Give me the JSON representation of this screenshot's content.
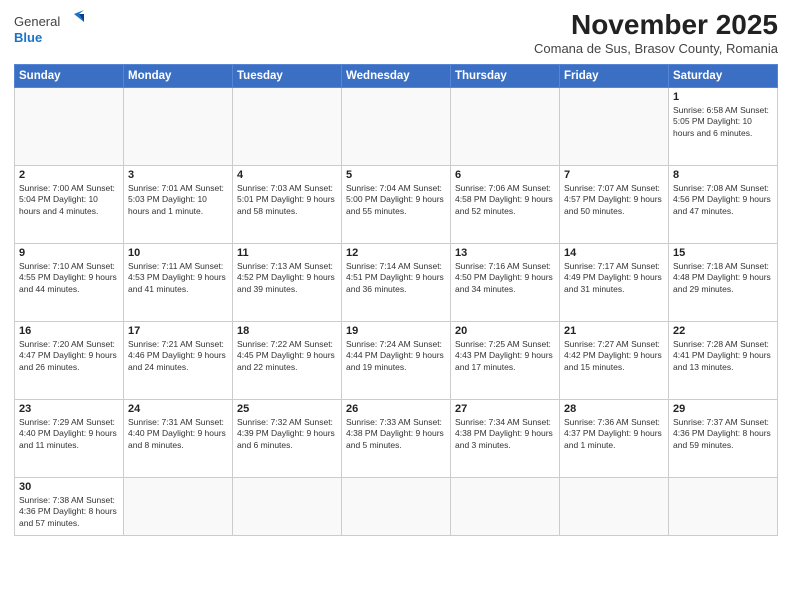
{
  "logo": {
    "general": "General",
    "blue": "Blue"
  },
  "header": {
    "month_title": "November 2025",
    "subtitle": "Comana de Sus, Brasov County, Romania"
  },
  "days_of_week": [
    "Sunday",
    "Monday",
    "Tuesday",
    "Wednesday",
    "Thursday",
    "Friday",
    "Saturday"
  ],
  "weeks": [
    [
      {
        "day": "",
        "info": ""
      },
      {
        "day": "",
        "info": ""
      },
      {
        "day": "",
        "info": ""
      },
      {
        "day": "",
        "info": ""
      },
      {
        "day": "",
        "info": ""
      },
      {
        "day": "",
        "info": ""
      },
      {
        "day": "1",
        "info": "Sunrise: 6:58 AM\nSunset: 5:05 PM\nDaylight: 10 hours and 6 minutes."
      }
    ],
    [
      {
        "day": "2",
        "info": "Sunrise: 7:00 AM\nSunset: 5:04 PM\nDaylight: 10 hours and 4 minutes."
      },
      {
        "day": "3",
        "info": "Sunrise: 7:01 AM\nSunset: 5:03 PM\nDaylight: 10 hours and 1 minute."
      },
      {
        "day": "4",
        "info": "Sunrise: 7:03 AM\nSunset: 5:01 PM\nDaylight: 9 hours and 58 minutes."
      },
      {
        "day": "5",
        "info": "Sunrise: 7:04 AM\nSunset: 5:00 PM\nDaylight: 9 hours and 55 minutes."
      },
      {
        "day": "6",
        "info": "Sunrise: 7:06 AM\nSunset: 4:58 PM\nDaylight: 9 hours and 52 minutes."
      },
      {
        "day": "7",
        "info": "Sunrise: 7:07 AM\nSunset: 4:57 PM\nDaylight: 9 hours and 50 minutes."
      },
      {
        "day": "8",
        "info": "Sunrise: 7:08 AM\nSunset: 4:56 PM\nDaylight: 9 hours and 47 minutes."
      }
    ],
    [
      {
        "day": "9",
        "info": "Sunrise: 7:10 AM\nSunset: 4:55 PM\nDaylight: 9 hours and 44 minutes."
      },
      {
        "day": "10",
        "info": "Sunrise: 7:11 AM\nSunset: 4:53 PM\nDaylight: 9 hours and 41 minutes."
      },
      {
        "day": "11",
        "info": "Sunrise: 7:13 AM\nSunset: 4:52 PM\nDaylight: 9 hours and 39 minutes."
      },
      {
        "day": "12",
        "info": "Sunrise: 7:14 AM\nSunset: 4:51 PM\nDaylight: 9 hours and 36 minutes."
      },
      {
        "day": "13",
        "info": "Sunrise: 7:16 AM\nSunset: 4:50 PM\nDaylight: 9 hours and 34 minutes."
      },
      {
        "day": "14",
        "info": "Sunrise: 7:17 AM\nSunset: 4:49 PM\nDaylight: 9 hours and 31 minutes."
      },
      {
        "day": "15",
        "info": "Sunrise: 7:18 AM\nSunset: 4:48 PM\nDaylight: 9 hours and 29 minutes."
      }
    ],
    [
      {
        "day": "16",
        "info": "Sunrise: 7:20 AM\nSunset: 4:47 PM\nDaylight: 9 hours and 26 minutes."
      },
      {
        "day": "17",
        "info": "Sunrise: 7:21 AM\nSunset: 4:46 PM\nDaylight: 9 hours and 24 minutes."
      },
      {
        "day": "18",
        "info": "Sunrise: 7:22 AM\nSunset: 4:45 PM\nDaylight: 9 hours and 22 minutes."
      },
      {
        "day": "19",
        "info": "Sunrise: 7:24 AM\nSunset: 4:44 PM\nDaylight: 9 hours and 19 minutes."
      },
      {
        "day": "20",
        "info": "Sunrise: 7:25 AM\nSunset: 4:43 PM\nDaylight: 9 hours and 17 minutes."
      },
      {
        "day": "21",
        "info": "Sunrise: 7:27 AM\nSunset: 4:42 PM\nDaylight: 9 hours and 15 minutes."
      },
      {
        "day": "22",
        "info": "Sunrise: 7:28 AM\nSunset: 4:41 PM\nDaylight: 9 hours and 13 minutes."
      }
    ],
    [
      {
        "day": "23",
        "info": "Sunrise: 7:29 AM\nSunset: 4:40 PM\nDaylight: 9 hours and 11 minutes."
      },
      {
        "day": "24",
        "info": "Sunrise: 7:31 AM\nSunset: 4:40 PM\nDaylight: 9 hours and 8 minutes."
      },
      {
        "day": "25",
        "info": "Sunrise: 7:32 AM\nSunset: 4:39 PM\nDaylight: 9 hours and 6 minutes."
      },
      {
        "day": "26",
        "info": "Sunrise: 7:33 AM\nSunset: 4:38 PM\nDaylight: 9 hours and 5 minutes."
      },
      {
        "day": "27",
        "info": "Sunrise: 7:34 AM\nSunset: 4:38 PM\nDaylight: 9 hours and 3 minutes."
      },
      {
        "day": "28",
        "info": "Sunrise: 7:36 AM\nSunset: 4:37 PM\nDaylight: 9 hours and 1 minute."
      },
      {
        "day": "29",
        "info": "Sunrise: 7:37 AM\nSunset: 4:36 PM\nDaylight: 8 hours and 59 minutes."
      }
    ],
    [
      {
        "day": "30",
        "info": "Sunrise: 7:38 AM\nSunset: 4:36 PM\nDaylight: 8 hours and 57 minutes."
      },
      {
        "day": "",
        "info": ""
      },
      {
        "day": "",
        "info": ""
      },
      {
        "day": "",
        "info": ""
      },
      {
        "day": "",
        "info": ""
      },
      {
        "day": "",
        "info": ""
      },
      {
        "day": "",
        "info": ""
      }
    ]
  ]
}
